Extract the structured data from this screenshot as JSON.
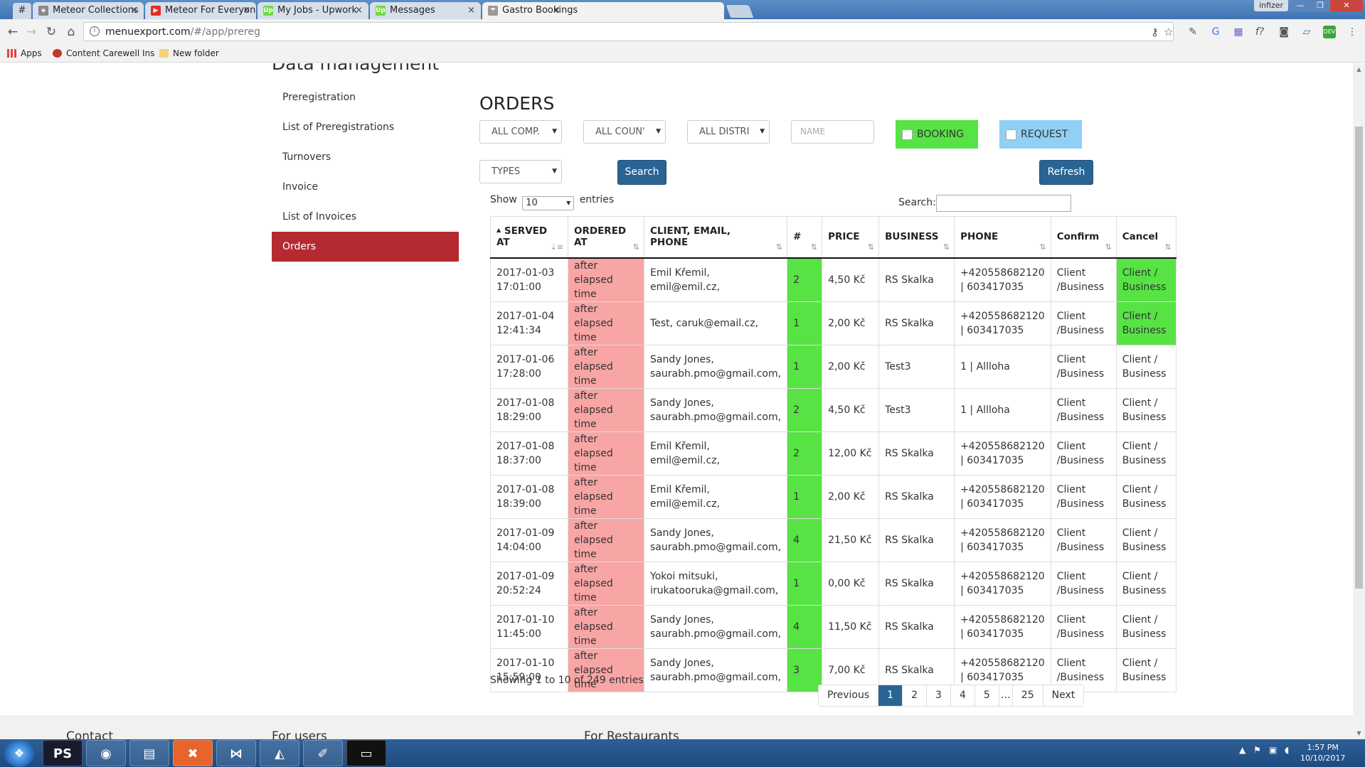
{
  "browser": {
    "pinned_tab": "#",
    "tabs": [
      {
        "label": "Meteor Collections",
        "icon": "meteor-icon",
        "icon_color": "#888888"
      },
      {
        "label": "Meteor For Everyone Tut",
        "icon": "youtube-icon",
        "icon_color": "#e52d27"
      },
      {
        "label": "My Jobs - Upwork",
        "icon": "upwork-icon",
        "icon_color": "#6fda44"
      },
      {
        "label": "Messages",
        "icon": "upwork-icon",
        "icon_color": "#6fda44"
      },
      {
        "label": "Gastro Bookings",
        "icon": "gastro-icon",
        "icon_color": "#999999"
      }
    ],
    "close_glyph": "×",
    "window_user": "infizer",
    "url_host": "menuexport.com",
    "url_path": "/#/app/prereg",
    "bookmarks": [
      {
        "label": "Apps",
        "icon": "apps-grid-icon"
      },
      {
        "label": "Content Carewell Ins",
        "icon": "carewell-icon"
      },
      {
        "label": "New folder",
        "icon": "folder-icon"
      }
    ]
  },
  "page": {
    "section_title": "Data management",
    "sidebar": [
      {
        "label": "Preregistration",
        "active": false
      },
      {
        "label": "List of Preregistrations",
        "active": false
      },
      {
        "label": "Turnovers",
        "active": false
      },
      {
        "label": "Invoice",
        "active": false
      },
      {
        "label": "List of Invoices",
        "active": false
      },
      {
        "label": "Orders",
        "active": true
      }
    ],
    "orders_title": "ORDERS",
    "filters": {
      "companies": "ALL COMP.",
      "countries": "ALL COUN'",
      "districts": "ALL DISTRI",
      "name_placeholder": "NAME",
      "booking_label": "BOOKING",
      "request_label": "REQUEST",
      "types": "TYPES",
      "search_button": "Search",
      "refresh_button": "Refresh"
    },
    "table_controls": {
      "show_label": "Show",
      "entries_value": "10",
      "entries_label": "entries",
      "search_label": "Search:"
    },
    "columns": [
      {
        "line1": "SERVED",
        "line2": "AT",
        "sort_indicator": "▲"
      },
      {
        "line1": "ORDERED",
        "line2": "AT"
      },
      {
        "line1": "CLIENT, EMAIL,",
        "line2": "PHONE"
      },
      {
        "line1": "#",
        "line2": ""
      },
      {
        "line1": "PRICE",
        "line2": ""
      },
      {
        "line1": "BUSINESS",
        "line2": ""
      },
      {
        "line1": "PHONE",
        "line2": ""
      },
      {
        "line1": "Confirm",
        "line2": ""
      },
      {
        "line1": "Cancel",
        "line2": ""
      }
    ],
    "rows": [
      {
        "served_date": "2017-01-03",
        "served_time": "17:01:00",
        "ordered1": "after elapsed",
        "ordered2": "time",
        "client1": "Emil Křemil,",
        "client2": "emil@emil.cz,",
        "count": "2",
        "price": "4,50 Kč",
        "business": "RS Skalka",
        "phone1": "+420558682120",
        "phone2": "| 603417035",
        "confirm1": "Client",
        "confirm2": "/Business",
        "cancel1": "Client /",
        "cancel2": "Business",
        "cancel_green": true
      },
      {
        "served_date": "2017-01-04",
        "served_time": "12:41:34",
        "ordered1": "after elapsed",
        "ordered2": "time",
        "client1": "Test, caruk@email.cz,",
        "client2": "",
        "count": "1",
        "price": "2,00 Kč",
        "business": "RS Skalka",
        "phone1": "+420558682120",
        "phone2": "| 603417035",
        "confirm1": "Client",
        "confirm2": "/Business",
        "cancel1": "Client /",
        "cancel2": "Business",
        "cancel_green": true
      },
      {
        "served_date": "2017-01-06",
        "served_time": "17:28:00",
        "ordered1": "after elapsed",
        "ordered2": "time",
        "client1": "Sandy Jones,",
        "client2": "saurabh.pmo@gmail.com,",
        "count": "1",
        "price": "2,00 Kč",
        "business": "Test3",
        "phone1": "1 | Allloha",
        "phone2": "",
        "confirm1": "Client",
        "confirm2": "/Business",
        "cancel1": "Client /",
        "cancel2": "Business",
        "cancel_green": false
      },
      {
        "served_date": "2017-01-08",
        "served_time": "18:29:00",
        "ordered1": "after elapsed",
        "ordered2": "time",
        "client1": "Sandy Jones,",
        "client2": "saurabh.pmo@gmail.com,",
        "count": "2",
        "price": "4,50 Kč",
        "business": "Test3",
        "phone1": "1 | Allloha",
        "phone2": "",
        "confirm1": "Client",
        "confirm2": "/Business",
        "cancel1": "Client /",
        "cancel2": "Business",
        "cancel_green": false
      },
      {
        "served_date": "2017-01-08",
        "served_time": "18:37:00",
        "ordered1": "after elapsed",
        "ordered2": "time",
        "client1": "Emil Křemil,",
        "client2": "emil@emil.cz,",
        "count": "2",
        "price": "12,00 Kč",
        "business": "RS Skalka",
        "phone1": "+420558682120",
        "phone2": "| 603417035",
        "confirm1": "Client",
        "confirm2": "/Business",
        "cancel1": "Client /",
        "cancel2": "Business",
        "cancel_green": false
      },
      {
        "served_date": "2017-01-08",
        "served_time": "18:39:00",
        "ordered1": "after elapsed",
        "ordered2": "time",
        "client1": "Emil Křemil,",
        "client2": "emil@emil.cz,",
        "count": "1",
        "price": "2,00 Kč",
        "business": "RS Skalka",
        "phone1": "+420558682120",
        "phone2": "| 603417035",
        "confirm1": "Client",
        "confirm2": "/Business",
        "cancel1": "Client /",
        "cancel2": "Business",
        "cancel_green": false
      },
      {
        "served_date": "2017-01-09",
        "served_time": "14:04:00",
        "ordered1": "after elapsed",
        "ordered2": "time",
        "client1": "Sandy Jones,",
        "client2": "saurabh.pmo@gmail.com,",
        "count": "4",
        "price": "21,50 Kč",
        "business": "RS Skalka",
        "phone1": "+420558682120",
        "phone2": "| 603417035",
        "confirm1": "Client",
        "confirm2": "/Business",
        "cancel1": "Client /",
        "cancel2": "Business",
        "cancel_green": false
      },
      {
        "served_date": "2017-01-09",
        "served_time": "20:52:24",
        "ordered1": "after elapsed",
        "ordered2": "time",
        "client1": "Yokoi mitsuki,",
        "client2": "irukatooruka@gmail.com,",
        "count": "1",
        "price": "0,00 Kč",
        "business": "RS Skalka",
        "phone1": "+420558682120",
        "phone2": "| 603417035",
        "confirm1": "Client",
        "confirm2": "/Business",
        "cancel1": "Client /",
        "cancel2": "Business",
        "cancel_green": false
      },
      {
        "served_date": "2017-01-10",
        "served_time": "11:45:00",
        "ordered1": "after elapsed",
        "ordered2": "time",
        "client1": "Sandy Jones,",
        "client2": "saurabh.pmo@gmail.com,",
        "count": "4",
        "price": "11,50 Kč",
        "business": "RS Skalka",
        "phone1": "+420558682120",
        "phone2": "| 603417035",
        "confirm1": "Client",
        "confirm2": "/Business",
        "cancel1": "Client /",
        "cancel2": "Business",
        "cancel_green": false
      },
      {
        "served_date": "2017-01-10",
        "served_time": "15:59:00",
        "ordered1": "after elapsed",
        "ordered2": "time",
        "client1": "Sandy Jones,",
        "client2": "saurabh.pmo@gmail.com,",
        "count": "3",
        "price": "7,00 Kč",
        "business": "RS Skalka",
        "phone1": "+420558682120",
        "phone2": "| 603417035",
        "confirm1": "Client",
        "confirm2": "/Business",
        "cancel1": "Client /",
        "cancel2": "Business",
        "cancel_green": false
      }
    ],
    "info_text": "Showing 1 to 10 of 249 entries",
    "pagination": {
      "previous": "Previous",
      "pages": [
        "1",
        "2",
        "3",
        "4",
        "5"
      ],
      "active_page": "1",
      "ellipsis": "…",
      "last": "25",
      "next": "Next"
    },
    "footer": {
      "contact": "Contact",
      "for_users": "For users",
      "for_restaurants": "For Restaurants"
    }
  },
  "taskbar": {
    "apps": [
      "PS",
      "chrome",
      "explorer",
      "xampp",
      "vscode",
      "robomongo",
      "notepad",
      "cmd"
    ],
    "clock_time": "1:57 PM",
    "clock_date": "10/10/2017"
  },
  "colors": {
    "accent_red": "#b52a31",
    "button_blue": "#2a6495",
    "booking_green": "#56e343",
    "request_blue": "#8fd0f4",
    "ordered_pink": "#f8a5a5"
  }
}
